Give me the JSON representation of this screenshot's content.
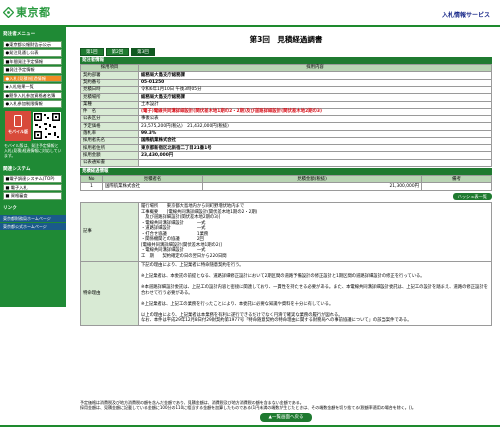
{
  "header": {
    "logo_text": "東京都",
    "service_title": "入札情報サービス"
  },
  "sidebar": {
    "menu_heading": "発注者メニュー",
    "items": [
      {
        "label": "●東京都公報財告示公示",
        "dot": "#1f8a35"
      },
      {
        "label": "●発注見通し公表",
        "dot": "#1f8a35"
      },
      {
        "label": "■年間発注予定情報",
        "dot": "#e05a1a"
      },
      {
        "label": "■発注予定情報",
        "dot": "#e05a1a"
      },
      {
        "label": "●入札(見積)経過情報",
        "dot": "#e05a1a"
      },
      {
        "label": "◆入札結果一覧",
        "dot": "#1f8a35"
      },
      {
        "label": "●競争入札参加資格者名簿",
        "dot": "#1f8a35"
      },
      {
        "label": "●入札参加制限情報",
        "dot": "#1f8a35"
      }
    ],
    "mobile_label": "モバイル版",
    "mobile_note": "モバイル版は、発注予定情報と入札(見積)経過情報に対応しています。",
    "system_heading": "関連システム",
    "system_items": [
      {
        "label": "■電子調達システム(TOP)",
        "dot": "#1f8a35"
      },
      {
        "label": "■ 電子入札",
        "dot": "#1f8a35"
      },
      {
        "label": "■ 資格審査",
        "dot": "#1f8a35"
      }
    ],
    "links_heading": "リンク",
    "links": [
      "東京都財務局ホームページ",
      "東京都公式ホームページ"
    ]
  },
  "main": {
    "title": "第3回　見積経過調書",
    "tabs": [
      "第1回",
      "第2回",
      "第3回"
    ],
    "info_section_title": "発注者情報",
    "info_header": {
      "item": "採用項目",
      "content": "採用内容"
    },
    "info_rows": [
      {
        "label": "契約部署",
        "value": "総務局大島支庁総務課",
        "style": "bold"
      },
      {
        "label": "契約番号",
        "value": "05-01250",
        "style": "bold"
      },
      {
        "label": "見積日時",
        "value": "令和6年1月10日 午後3時05分",
        "style": ""
      },
      {
        "label": "見積場所",
        "value": "総務局大島支庁総務課",
        "style": "bold"
      },
      {
        "label": "業種",
        "value": "土木設計",
        "style": ""
      },
      {
        "label": "件　名",
        "value": "(電子)電線共同溝詳細設計(関伏差木地1期の2・2期)及び道路詳細設計(関伏差木地2期の3)",
        "style": "red"
      },
      {
        "label": "公表区分",
        "value": "事後公表",
        "style": ""
      },
      {
        "label": "予定価格",
        "value": "23,575,200円(税込)　21,432,000円(税抜)",
        "style": ""
      },
      {
        "label": "落札率",
        "value": "99.3%",
        "style": "bold"
      },
      {
        "label": "採用者氏名",
        "value": "国際航業株式会社",
        "style": "bold"
      },
      {
        "label": "採用者住所",
        "value": "東京都新宿区北新宿二丁目21番1号",
        "style": "bold"
      },
      {
        "label": "採用金額",
        "value": "23,430,000円",
        "style": "bold"
      },
      {
        "label": "公表通知書",
        "value": "",
        "style": ""
      }
    ],
    "bid_section_title": "見積経過情報",
    "bid_headers": [
      "No",
      "見積者名",
      "見積金額(税抜)",
      "備考"
    ],
    "bid_rows": [
      {
        "no": "1",
        "name": "国際航業株式会社",
        "amount": "21,300,000円",
        "note": ""
      }
    ],
    "history_button": "ハッシュ表一覧",
    "remarks_label": "記事",
    "remarks_text": "履行場所　　東京都大島地内から同町野増伏地内まで\n工事概要　　[電線共同溝詳細設計(関伏差木地1期の2・2期)\n　及び道路詳細設計(関伏差木地2期の3)]\n・電線共同溝詳細設計　　　一式\n・道路詳細設計　　　　　　一式\n・打合せ協議　　　　　　　1業務\n・関係機関との協議　　　　2回\n[電線共同溝詳細設計(関伏差木地1期の2)]\n・電線共同溝詳細設計　　　一式\n工　期　　契約確定の日の翌日から220日間",
    "reason_label": "特命理由",
    "reason_text": "下記の理由により、上記業者に特命随意契約を行う。\n\n※上記業者は、本委託の前提となる、道路詳細修正設計において2期区間の道路予備設計の修正設計と1期区間の道路詳細設計の修正を行っている。\n\n※本道路詳細設計委託は、上記工の設計内容と密接に関連しており、一貫性を持たせる必要がある。また、本電線共同溝詳細設計委託は、上記工の設計を踏まえ、道路の修正設計を合わせて行う必要がある。\n\n※上記業者は、上記工の業務を行ったことにより、本委託に必要な知識や資料を十分に有している。\n\n以上の理由により、上記業者は本業務を有利に遂行できるだけでなく円滑で確実な業務の履行が図れる。\nなお、本件は平成29年12月8日付29財契約第1977号「特命随意契約の特命理由に関する財務局への事前協議について」の該当案件である。"
  },
  "notes": [
    "予定価格は消費税及び地方消費税の額を含んだ金額であり、見積金額は、消費税及び地方消費税の額を含まない金額である。",
    "採用金額は、見積金額に記載している金額に100分の110に相当する金額を加算したものである(1円未満の端数が生じたときは、その端数金額を切り捨てる(税額率適用の場合を除く。))。"
  ],
  "back_button": "▲一覧画面へ戻る",
  "colors": {
    "brand_green": "#1f8a35",
    "header_green": "#1f7a30",
    "label_bg": "#d8ead4",
    "highlight_red": "#d8101a"
  }
}
